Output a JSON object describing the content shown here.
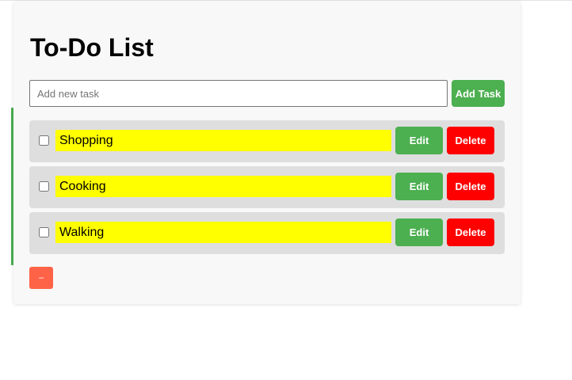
{
  "app": {
    "title": "To-Do List"
  },
  "new_task": {
    "placeholder": "Add new task",
    "value": "",
    "add_label": "Add Task"
  },
  "tasks": [
    {
      "text": "Shopping",
      "done": false,
      "edit_label": "Edit",
      "delete_label": "Delete"
    },
    {
      "text": "Cooking",
      "done": false,
      "edit_label": "Edit",
      "delete_label": "Delete"
    },
    {
      "text": "Walking",
      "done": false,
      "edit_label": "Edit",
      "delete_label": "Delete"
    }
  ],
  "footer": {
    "minus_label": "–"
  },
  "colors": {
    "accent_green": "#4caf50",
    "delete_red": "#ff0000",
    "highlight_yellow": "#ffff00",
    "row_bg": "#dedede",
    "card_bg": "#f8f8f8",
    "minus_button": "#ff6347"
  }
}
